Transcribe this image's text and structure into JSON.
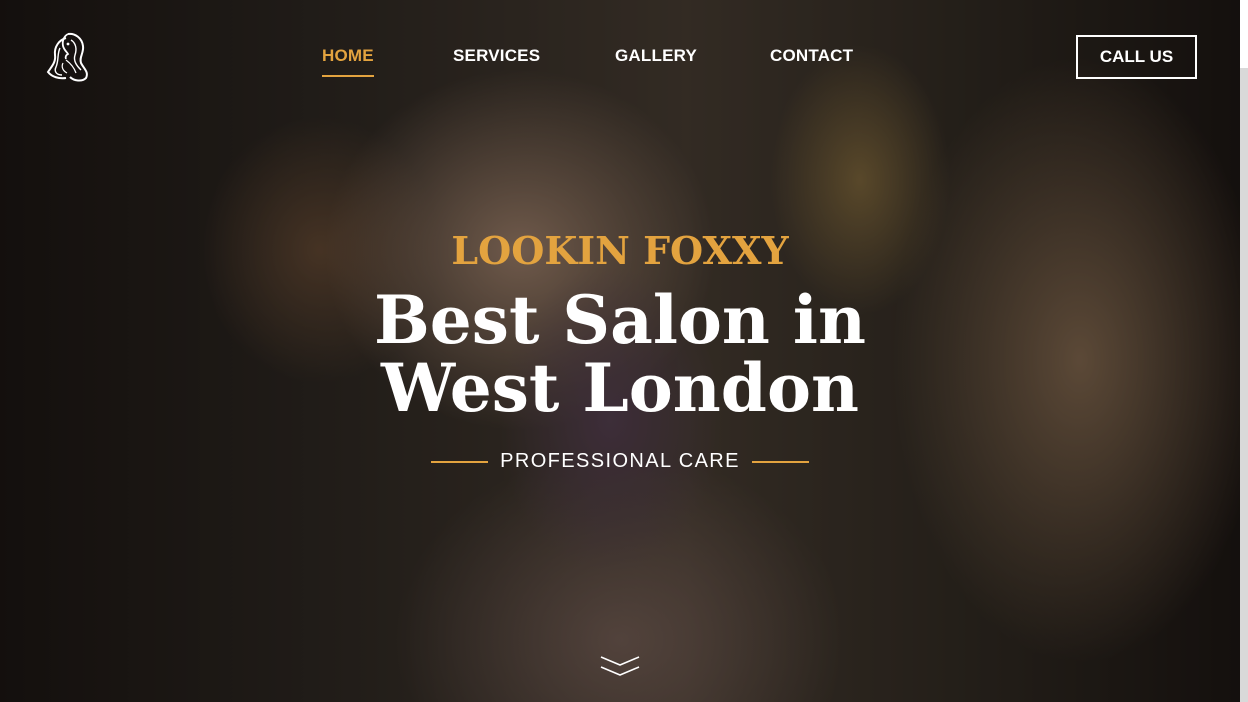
{
  "nav": {
    "items": [
      {
        "label": "HOME",
        "active": true
      },
      {
        "label": "SERVICES",
        "active": false
      },
      {
        "label": "GALLERY",
        "active": false
      },
      {
        "label": "CONTACT",
        "active": false
      }
    ],
    "call_label": "CALL US"
  },
  "hero": {
    "eyebrow": "LOOKIN FOXXY",
    "headline_line1": "Best Salon in",
    "headline_line2": "West London",
    "tagline": "PROFESSIONAL CARE"
  },
  "icons": {
    "logo": "woman-hair-logo-icon",
    "scroll": "chevron-double-down-icon"
  },
  "colors": {
    "accent": "#e3a33f",
    "text": "#ffffff"
  }
}
